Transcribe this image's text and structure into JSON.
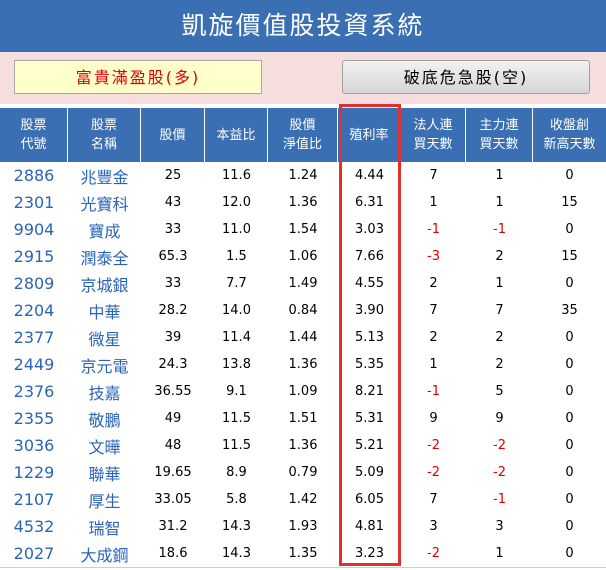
{
  "title": "凱旋價值股投資系統",
  "buttons": {
    "bull": "富貴滿盈股(多)",
    "bear": "破底危急股(空)"
  },
  "columns": [
    [
      "股票",
      "代號"
    ],
    [
      "股票",
      "名稱"
    ],
    [
      "股價"
    ],
    [
      "本益比"
    ],
    [
      "股價",
      "淨值比"
    ],
    [
      "殖利率"
    ],
    [
      "法人連",
      "買天數"
    ],
    [
      "主力連",
      "買天數"
    ],
    [
      "收盤創",
      "新高天數"
    ]
  ],
  "rows": [
    [
      "2886",
      "兆豐金",
      "25",
      "11.6",
      "1.24",
      "4.44",
      "7",
      "1",
      "0"
    ],
    [
      "2301",
      "光寶科",
      "43",
      "12.0",
      "1.36",
      "6.31",
      "1",
      "1",
      "15"
    ],
    [
      "9904",
      "寶成",
      "33",
      "11.0",
      "1.54",
      "3.03",
      "-1",
      "-1",
      "0"
    ],
    [
      "2915",
      "潤泰全",
      "65.3",
      "1.5",
      "1.06",
      "7.66",
      "-3",
      "2",
      "15"
    ],
    [
      "2809",
      "京城銀",
      "33",
      "7.7",
      "1.49",
      "4.55",
      "2",
      "1",
      "0"
    ],
    [
      "2204",
      "中華",
      "28.2",
      "14.0",
      "0.84",
      "3.90",
      "7",
      "7",
      "35"
    ],
    [
      "2377",
      "微星",
      "39",
      "11.4",
      "1.44",
      "5.13",
      "2",
      "2",
      "0"
    ],
    [
      "2449",
      "京元電",
      "24.3",
      "13.8",
      "1.36",
      "5.35",
      "1",
      "2",
      "0"
    ],
    [
      "2376",
      "技嘉",
      "36.55",
      "9.1",
      "1.09",
      "8.21",
      "-1",
      "5",
      "0"
    ],
    [
      "2355",
      "敬鵬",
      "49",
      "11.5",
      "1.51",
      "5.31",
      "9",
      "9",
      "0"
    ],
    [
      "3036",
      "文曄",
      "48",
      "11.5",
      "1.36",
      "5.21",
      "-2",
      "-2",
      "0"
    ],
    [
      "1229",
      "聯華",
      "19.65",
      "8.9",
      "0.79",
      "5.09",
      "-2",
      "-2",
      "0"
    ],
    [
      "2107",
      "厚生",
      "33.05",
      "5.8",
      "1.42",
      "6.05",
      "7",
      "-1",
      "0"
    ],
    [
      "4532",
      "瑞智",
      "31.2",
      "14.3",
      "1.93",
      "4.81",
      "3",
      "3",
      "0"
    ],
    [
      "2027",
      "大成鋼",
      "18.6",
      "14.3",
      "1.35",
      "3.23",
      "-2",
      "1",
      "0"
    ]
  ]
}
